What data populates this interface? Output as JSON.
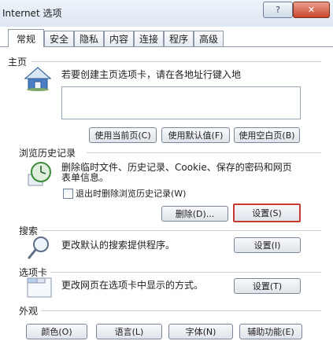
{
  "window": {
    "title": "Internet 选项",
    "help_glyph": "?",
    "close_glyph": "✕"
  },
  "tabs": [
    {
      "label": "常规",
      "active": true
    },
    {
      "label": "安全"
    },
    {
      "label": "隐私"
    },
    {
      "label": "内容"
    },
    {
      "label": "连接"
    },
    {
      "label": "程序"
    },
    {
      "label": "高级"
    }
  ],
  "home": {
    "label": "主页",
    "description": "若要创建主页选项卡，请在各地址行键入地",
    "url_value": "",
    "buttons": [
      "使用当前页(C)",
      "使用默认值(F)",
      "使用空白页(B)"
    ]
  },
  "history": {
    "label": "浏览历史记录",
    "description_line1": "删除临时文件、历史记录、Cookie、保存的密码和网页",
    "description_line2": "表单信息。",
    "checkbox_label": "退出时删除浏览历史记录(W)",
    "checkbox_checked": false,
    "delete_button": "删除(D)...",
    "settings_button": "设置(S)"
  },
  "search": {
    "label": "搜索",
    "description": "更改默认的搜索提供程序。",
    "settings_button": "设置(I)"
  },
  "tabs_section": {
    "label": "选项卡",
    "description": "更改网页在选项卡中显示的方式。",
    "settings_button": "设置(T)"
  },
  "appearance": {
    "label": "外观",
    "buttons": [
      "颜色(O)",
      "语言(L)",
      "字体(N)",
      "辅助功能(E)"
    ]
  }
}
